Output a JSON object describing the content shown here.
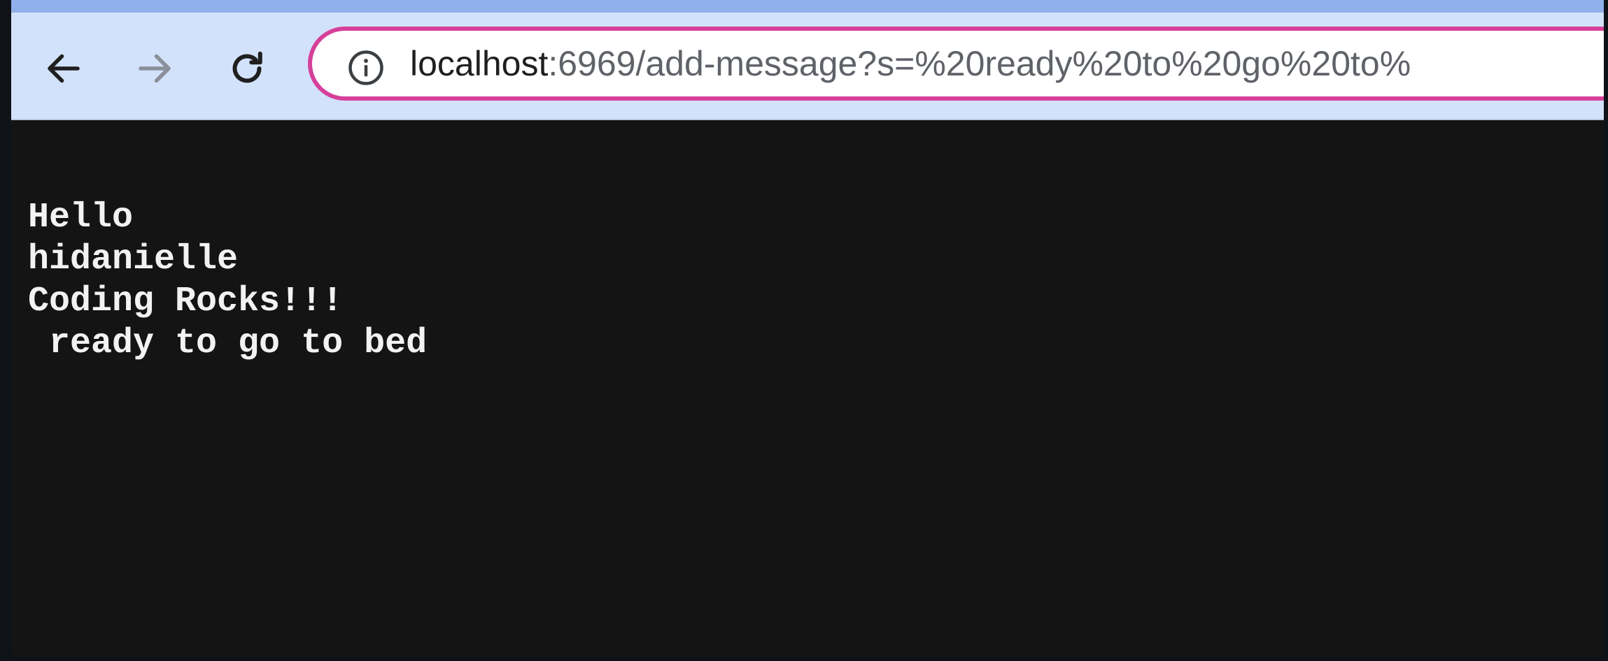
{
  "browser": {
    "address_bar": {
      "host": "localhost",
      "rest": ":6969/add-message?s=%20ready%20to%20go%20to%"
    },
    "accent_colors": {
      "toolbar": "#d3e2fb",
      "omnibox_border": "#d6409a",
      "page_background": "#141414",
      "text": "#f2f2f2"
    }
  },
  "page": {
    "messages": [
      "Hello",
      "hidanielle",
      "Coding Rocks!!!",
      " ready to go to bed"
    ]
  },
  "icons": {
    "back": "arrow-left-icon",
    "forward": "arrow-right-icon",
    "reload": "reload-icon",
    "site_info": "info-icon"
  }
}
